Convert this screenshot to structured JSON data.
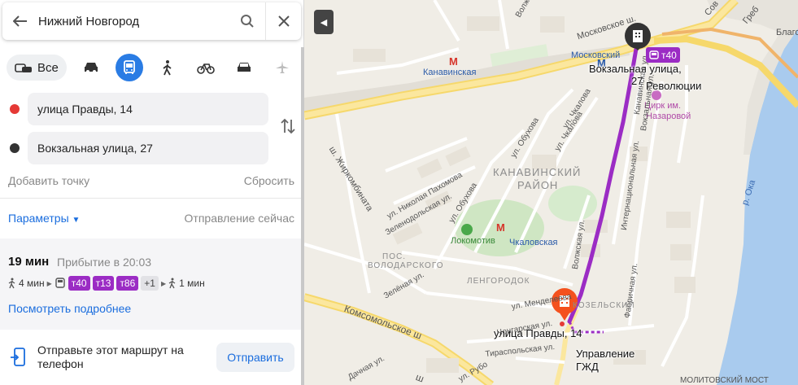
{
  "search": {
    "query": "Нижний Новгород"
  },
  "modes": {
    "all_label": "Все",
    "active": "bus"
  },
  "route_points": {
    "from": "улица Правды, 14",
    "to": "Вокзальная улица, 27",
    "from_color": "#e53935",
    "to_color": "#333333"
  },
  "actions": {
    "add_point": "Добавить точку",
    "reset": "Сбросить"
  },
  "params": {
    "label": "Параметры",
    "departure": "Отправление сейчас"
  },
  "route": {
    "duration": "19 мин",
    "arrival": "Прибытие в 20:03",
    "walk_before": "4 мин",
    "buses": [
      "т40",
      "т13",
      "т86"
    ],
    "more": "+1",
    "walk_after": "1 мин",
    "details_link": "Посмотреть подробнее",
    "line_color": "#9b2cc4"
  },
  "send": {
    "text": "Отправьте этот маршрут на телефон",
    "button": "Отправить"
  },
  "map": {
    "labels": {
      "moskovskoe": "Московское ш.",
      "sov": "Сов",
      "greb": "Греб",
      "blago": "Благо",
      "kanavinskaya_metro": "Канавинская",
      "moskovsky_metro": "Московский",
      "vokzal_top": "Вокзальная улица,",
      "vokzal_bottom": "27",
      "revolyutsii": "Революции",
      "tsirk": "Цирк им.",
      "nazarovoi": "Назаровой",
      "district_1": "КАНАВИНСКИЙ",
      "district_2": "РАЙОН",
      "chkalovskaya": "Чкаловская",
      "lokomotiv": "Локомотив",
      "pos_1": "ПОС.",
      "pos_2": "ВОЛОДАРСКОГО",
      "lengorodok": "ЛЕНГОРОДОК",
      "ul_pravdy": "улица Правды, 14",
      "upravlenie": "Управление",
      "gzhd": "ГЖД",
      "komsomolskoe": "Комсомольское ш",
      "zhirokombinata": "ш. Жиркомбината",
      "pahomova": "ул. Николая Пахомова",
      "zelenodolskaya": "Зеленодольская ул.",
      "obuhova": "ул. Обухова",
      "obuhova2": "ул. Обухова",
      "chkalova": "ул. Чкалова",
      "chkalova2": "ул. Чкалова",
      "volskaya": "Волжская ул.",
      "vokzalnaya": "Вокзальная ул.",
      "internatsionalnaya": "Интернациональная ул.",
      "fabrichnaya": "Фабричная ул.",
      "mendeleeva": "ул. Менделеева",
      "chongarskaya": "Чонгарская ул.",
      "tiraspolskaya": "Тираспольская ул.",
      "dachnaya": "Дачная ул.",
      "rubo": "ул. Рубо",
      "zelenaya": "Зелёная ул.",
      "kozelsky": "КОЗЕЛЬСКИЙ",
      "oka": "р. Ока",
      "molitovsky": "МОЛИТОВСКИЙ МОСТ",
      "volskaya_top": "Волжская",
      "kanavinsky_ul": "Канавинская ул.",
      "stop_bus": "т40",
      "revolution_short": "ь",
      "moskovskoe2": "Московское",
      "shosse": "ш"
    }
  }
}
